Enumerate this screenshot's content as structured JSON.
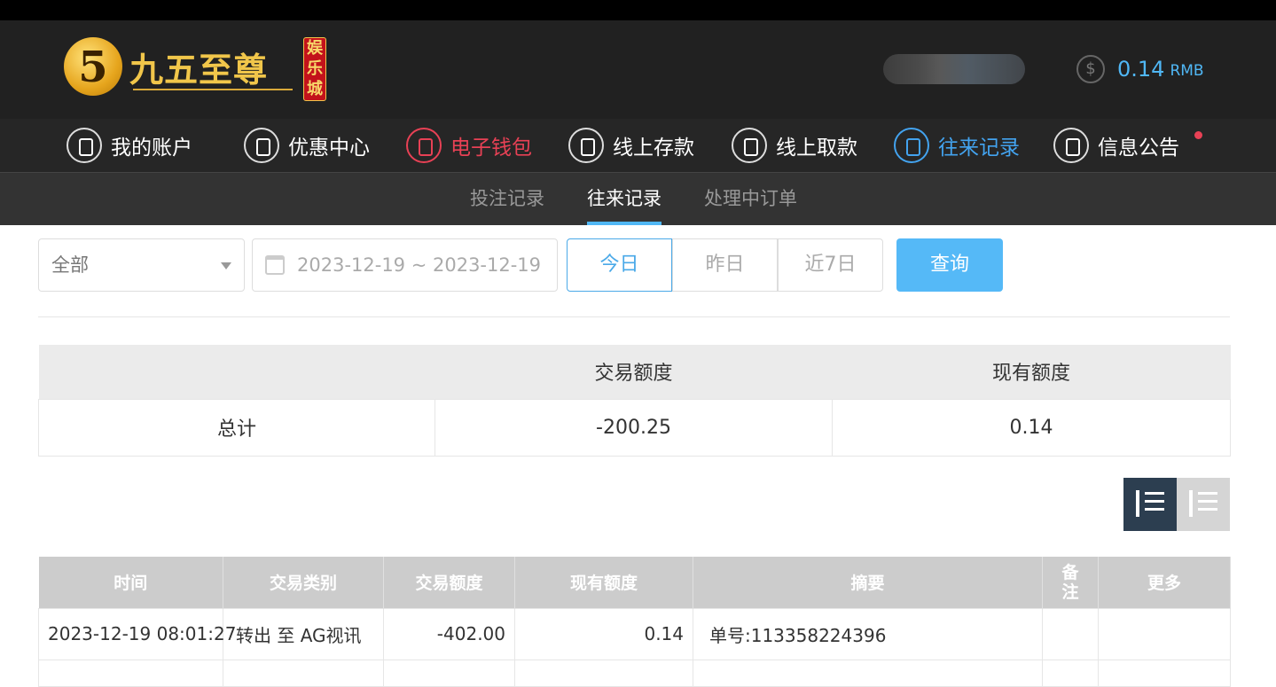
{
  "header": {
    "logo_text": "九五至尊",
    "logo_badge": "娱乐城",
    "balance_value": "0.14",
    "balance_unit": "RMB"
  },
  "nav": [
    {
      "label": "我的账户"
    },
    {
      "label": "优惠中心"
    },
    {
      "label": "电子钱包"
    },
    {
      "label": "线上存款"
    },
    {
      "label": "线上取款"
    },
    {
      "label": "往来记录"
    },
    {
      "label": "信息公告"
    }
  ],
  "subnav": [
    {
      "label": "投注记录"
    },
    {
      "label": "往来记录"
    },
    {
      "label": "处理中订单"
    }
  ],
  "filters": {
    "type_selected": "全部",
    "date_range": "2023-12-19 ~ 2023-12-19",
    "quick": [
      "今日",
      "昨日",
      "近7日"
    ],
    "query_label": "查询"
  },
  "summary": {
    "headers": [
      "",
      "交易额度",
      "现有额度"
    ],
    "row": [
      "总计",
      "-200.25",
      "0.14"
    ]
  },
  "records": {
    "headers": [
      "时间",
      "交易类别",
      "交易额度",
      "现有额度",
      "摘要",
      "备注",
      "更多"
    ],
    "rows": [
      [
        "2023-12-19 08:01:27",
        "转出 至 AG视讯",
        "-402.00",
        "0.14",
        "单号:113358224396",
        "",
        ""
      ]
    ]
  },
  "colors": {
    "accent_blue": "#50b7f5",
    "wallet_red": "#e84155",
    "header_bg": "#212121"
  }
}
